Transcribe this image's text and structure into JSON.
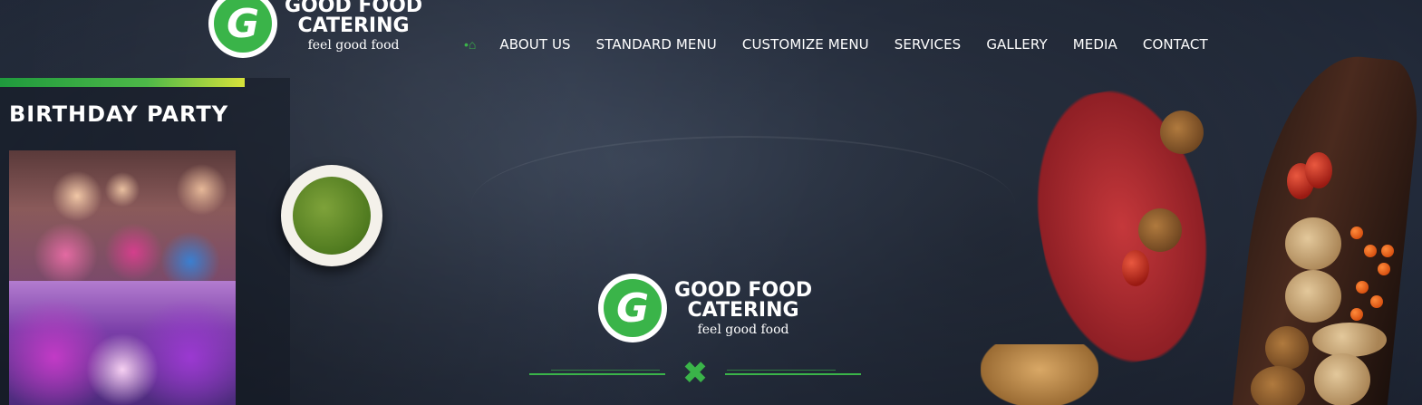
{
  "brand": {
    "name_line1": "GOOD FOOD",
    "name_line2": "CATERING",
    "tagline": "feel good food",
    "logo_letter": "G",
    "accent": "#3ab449"
  },
  "nav": {
    "home_icon": "home-icon",
    "items": [
      "ABOUT US",
      "STANDARD MENU",
      "CUSTOMIZE MENU",
      "SERVICES",
      "GALLERY",
      "MEDIA",
      "CONTACT"
    ]
  },
  "sidebar": {
    "title": "BIRTHDAY PARTY",
    "photos": [
      "birthday-children-photo",
      "party-decoration-photo"
    ]
  },
  "center": {
    "divider_icon": "fork-spoon-icon"
  }
}
